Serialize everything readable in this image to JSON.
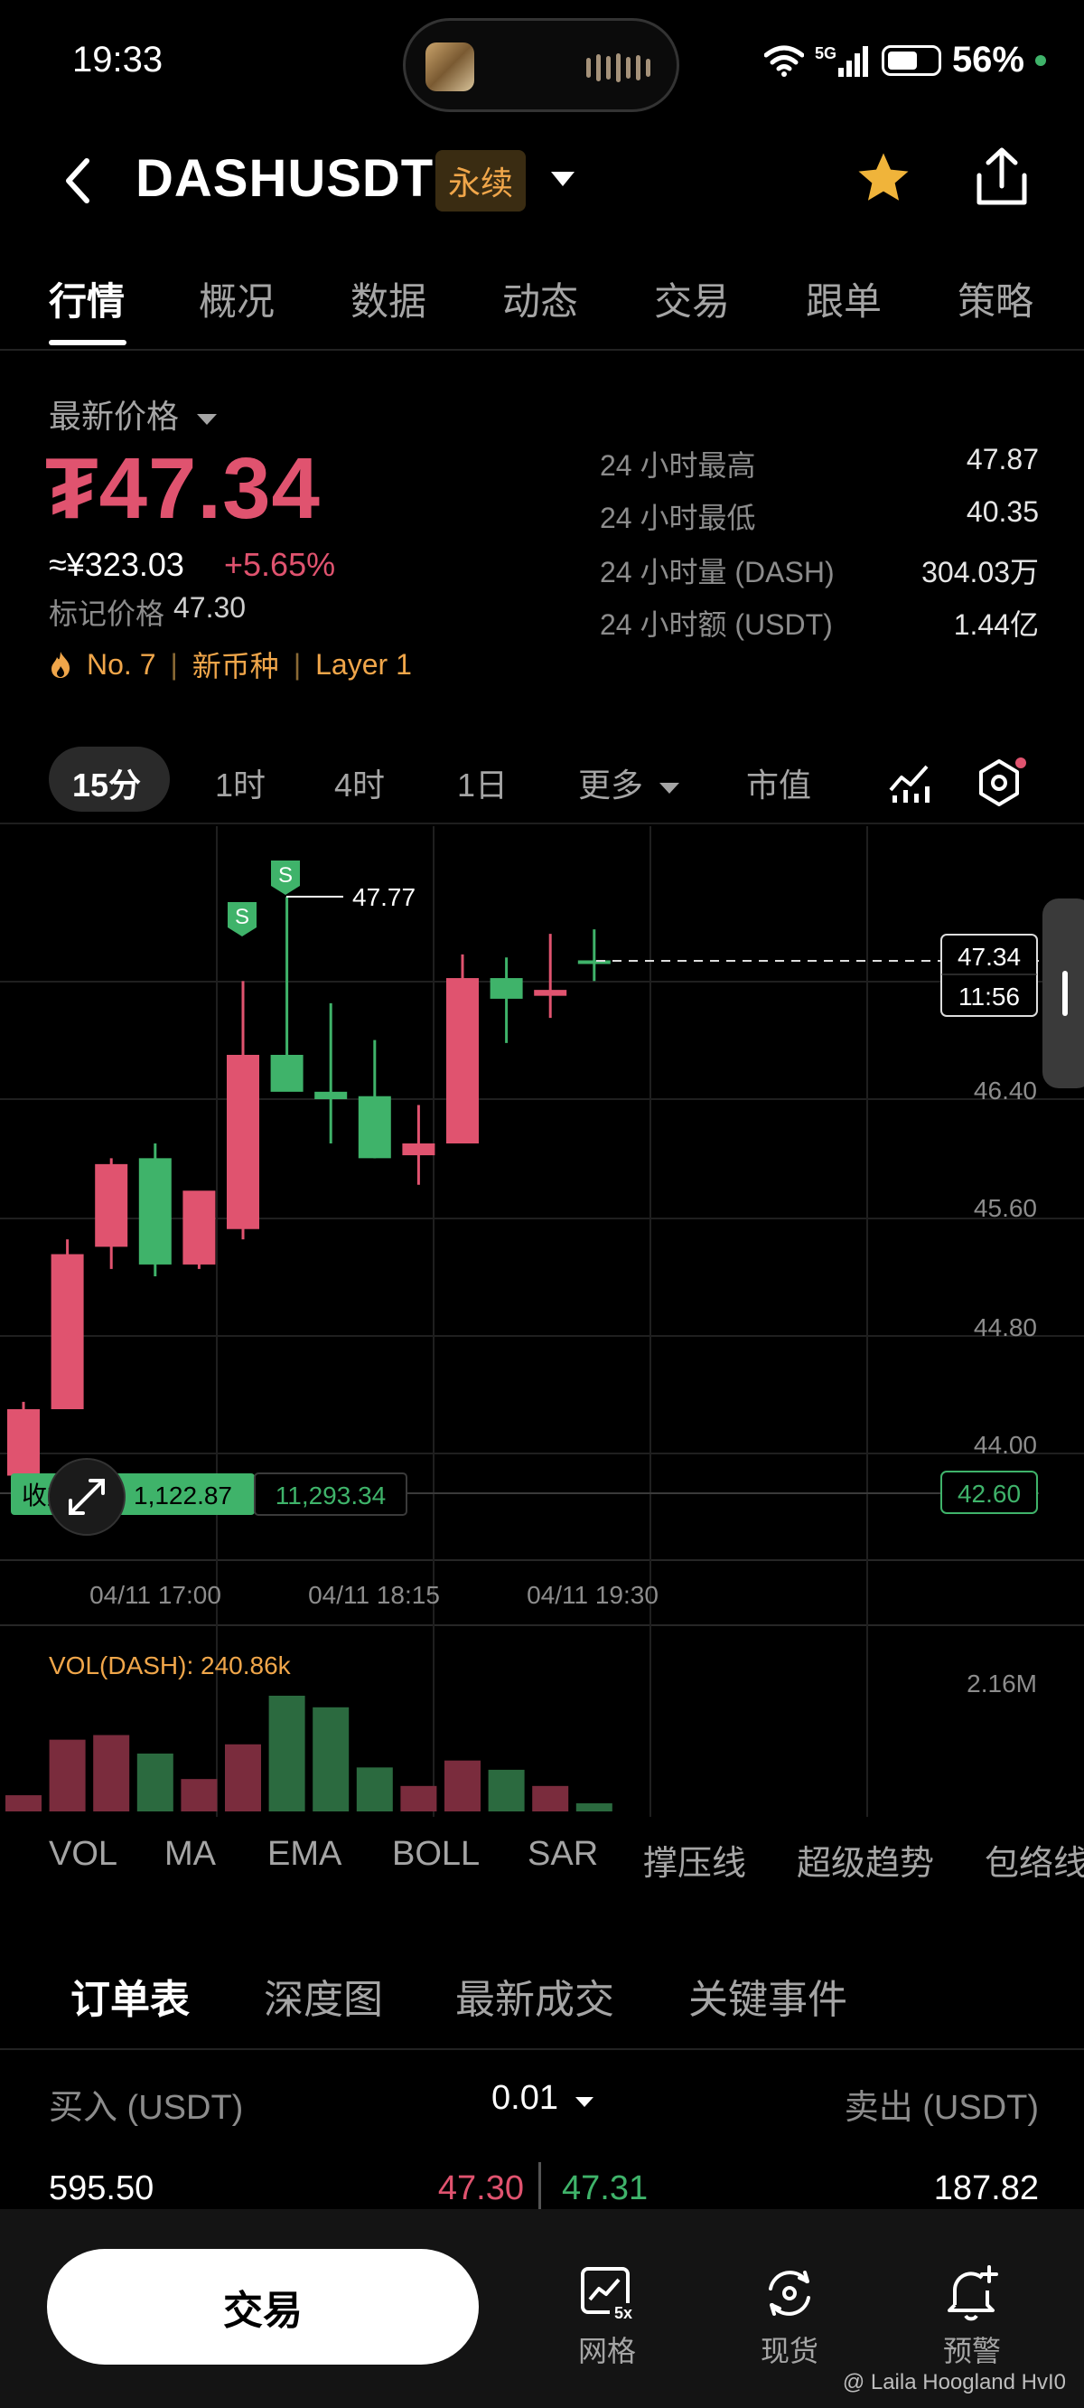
{
  "status_bar": {
    "time": "19:33",
    "network": "5G",
    "battery": "56%"
  },
  "header": {
    "symbol": "DASHUSDT",
    "contract_type": "永续"
  },
  "tabs": [
    "行情",
    "概况",
    "数据",
    "动态",
    "交易",
    "跟单",
    "策略"
  ],
  "price": {
    "label": "最新价格",
    "last": "₮47.34",
    "cny": "≈¥323.03",
    "change": "+5.65%",
    "mark_label": "标记价格",
    "mark": "47.30",
    "tags": [
      "No. 7",
      "新币种",
      "Layer 1"
    ]
  },
  "stats": [
    {
      "k": "24 小时最高",
      "v": "47.87"
    },
    {
      "k": "24 小时最低",
      "v": "40.35"
    },
    {
      "k": "24 小时量 (DASH)",
      "v": "304.03万"
    },
    {
      "k": "24 小时额 (USDT)",
      "v": "1.44亿"
    }
  ],
  "intervals": [
    "15分",
    "1时",
    "4时",
    "1日",
    "更多",
    "市值"
  ],
  "chart": {
    "price_axis": [
      "46.40",
      "45.60",
      "44.80",
      "44.00"
    ],
    "current_price": "47.34",
    "countdown": "11:56",
    "peak_label": "47.77",
    "low_box": "42.60",
    "signal_label": "S",
    "position_left": "收益",
    "position_pnl": "1,122.87",
    "position_size": "11,293.34",
    "time_axis": [
      "04/11 17:00",
      "04/11 18:15",
      "04/11 19:30"
    ],
    "vol_label": "VOL(DASH): 240.86k",
    "vol_axis": "2.16M"
  },
  "chart_data": {
    "type": "candlestick",
    "interval": "15分",
    "x": [
      "04/11 17:00",
      "04/11 18:15",
      "04/11 19:30"
    ],
    "price_axis_ticks": [
      46.4,
      45.6,
      44.8,
      44.0
    ],
    "candles": [
      {
        "o": 43.85,
        "h": 44.35,
        "l": 43.72,
        "c": 44.3,
        "dir": "up"
      },
      {
        "o": 44.3,
        "h": 45.45,
        "l": 44.3,
        "c": 45.35,
        "dir": "up"
      },
      {
        "o": 45.4,
        "h": 46.0,
        "l": 45.25,
        "c": 45.96,
        "dir": "up"
      },
      {
        "o": 46.0,
        "h": 46.1,
        "l": 45.2,
        "c": 45.28,
        "dir": "down"
      },
      {
        "o": 45.28,
        "h": 45.75,
        "l": 45.25,
        "c": 45.78,
        "dir": "up"
      },
      {
        "o": 45.52,
        "h": 47.2,
        "l": 45.45,
        "c": 46.7,
        "dir": "up"
      },
      {
        "o": 46.7,
        "h": 47.77,
        "l": 46.55,
        "c": 46.45,
        "dir": "down"
      },
      {
        "o": 46.45,
        "h": 47.05,
        "l": 46.1,
        "c": 46.4,
        "dir": "down"
      },
      {
        "o": 46.42,
        "h": 46.8,
        "l": 46.0,
        "c": 46.0,
        "dir": "down"
      },
      {
        "o": 46.02,
        "h": 46.36,
        "l": 45.82,
        "c": 46.1,
        "dir": "up"
      },
      {
        "o": 46.1,
        "h": 47.38,
        "l": 46.1,
        "c": 47.22,
        "dir": "up"
      },
      {
        "o": 47.22,
        "h": 47.36,
        "l": 46.78,
        "c": 47.08,
        "dir": "down"
      },
      {
        "o": 47.1,
        "h": 47.52,
        "l": 46.95,
        "c": 47.14,
        "dir": "up"
      },
      {
        "o": 47.34,
        "h": 47.55,
        "l": 47.2,
        "c": 47.34,
        "dir": "down"
      }
    ],
    "volume_axis_max": "2.16M",
    "volume_label": "VOL(DASH): 240.86k",
    "volumes": [
      0.14,
      0.62,
      0.66,
      0.5,
      0.28,
      0.58,
      1.0,
      0.9,
      0.38,
      0.22,
      0.44,
      0.36,
      0.22,
      0.07
    ],
    "volume_dir": [
      "up",
      "up",
      "up",
      "down",
      "up",
      "up",
      "down",
      "down",
      "down",
      "up",
      "up",
      "down",
      "up",
      "down"
    ]
  },
  "indicators": [
    "VOL",
    "MA",
    "EMA",
    "BOLL",
    "SAR",
    "撑压线",
    "超级趋势",
    "包络线"
  ],
  "order_tabs": [
    "订单表",
    "深度图",
    "最新成交",
    "关键事件"
  ],
  "orderbook": {
    "buy_label": "买入 (USDT)",
    "precision": "0.01",
    "sell_label": "卖出 (USDT)",
    "rows": [
      {
        "bid_size": "595.50",
        "bid": "47.30",
        "ask": "47.31",
        "ask_size": "187.82"
      }
    ]
  },
  "bottom": {
    "trade": "交易",
    "nav": [
      "网格",
      "现货",
      "预警"
    ],
    "grid_badge": "5x"
  },
  "watermark": "@ Laila Hoogland HvI0",
  "colors": {
    "up": "#e0536f",
    "down": "#3fb36a",
    "accent": "#f0a64a"
  }
}
